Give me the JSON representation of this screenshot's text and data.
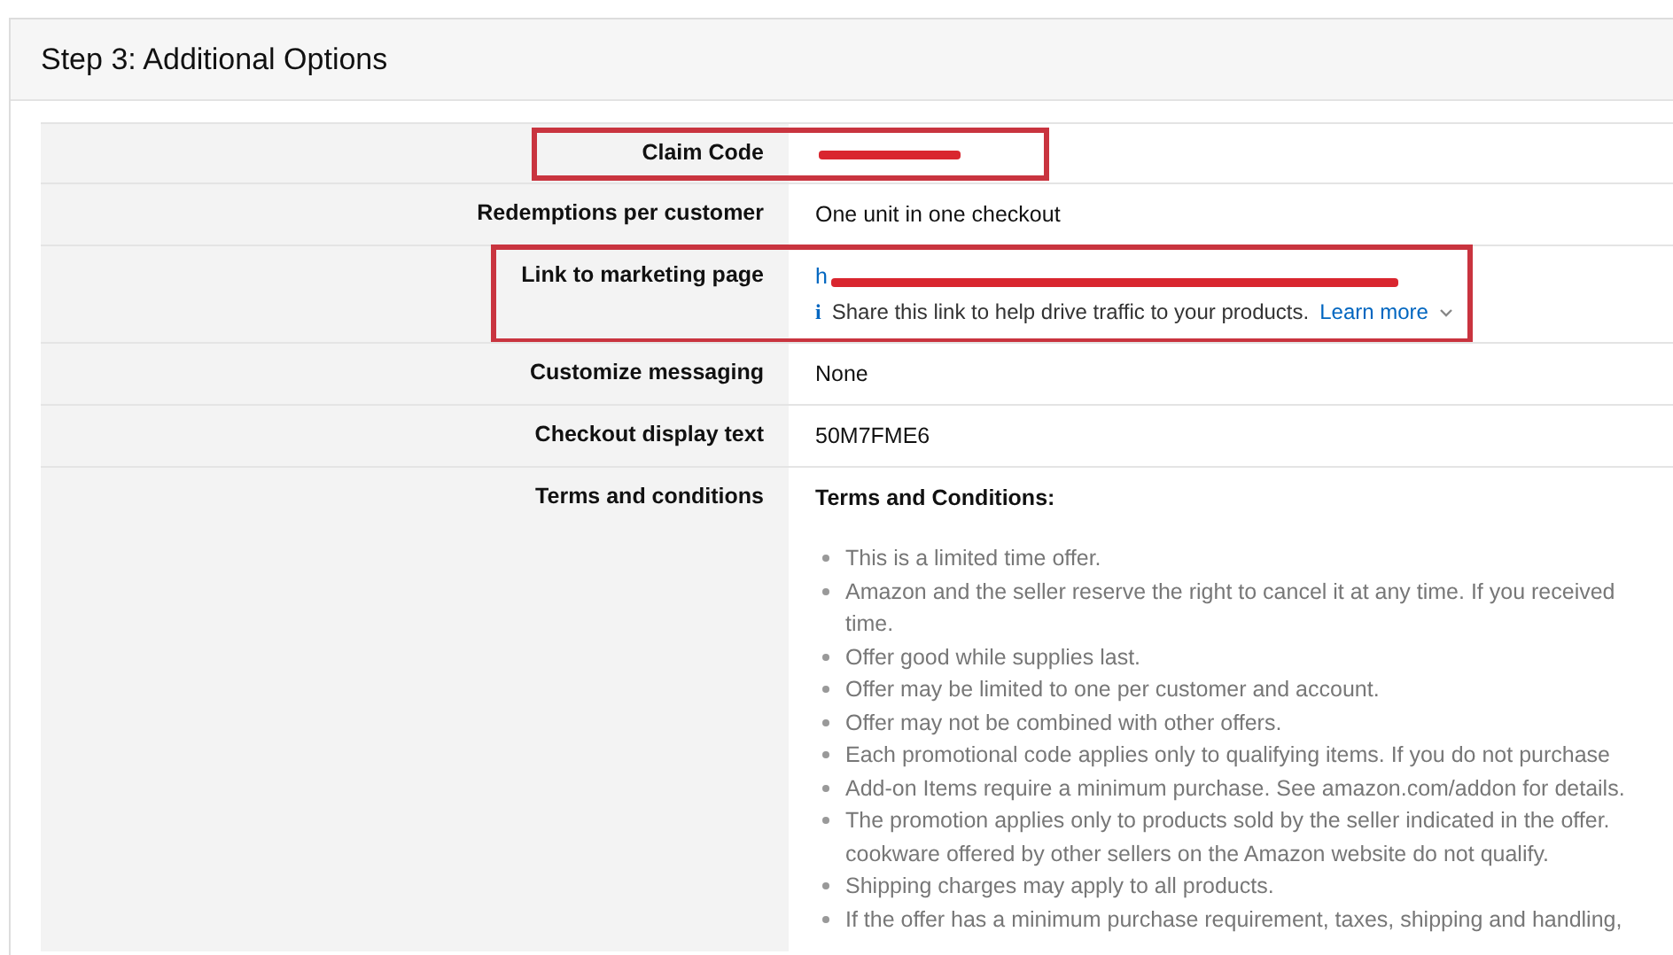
{
  "section_title": "Step 3: Additional Options",
  "rows": [
    {
      "label": "Claim Code",
      "kind": "redacted",
      "highlighted": true
    },
    {
      "label": "Redemptions per customer",
      "kind": "text",
      "value": "One unit in one checkout",
      "highlighted": false
    },
    {
      "label": "Link to marketing page",
      "kind": "link",
      "value": "h",
      "redacted": true,
      "highlighted": true,
      "info_icon": "i",
      "hint": "Share this link to help drive traffic to your products.",
      "hint_link": "Learn more"
    },
    {
      "label": "Customize messaging",
      "kind": "text",
      "value": "None",
      "highlighted": false
    },
    {
      "label": "Checkout display text",
      "kind": "text",
      "value": "50M7FME6",
      "highlighted": false
    },
    {
      "label": "Terms and conditions",
      "kind": "terms",
      "highlighted": false,
      "heading": "Terms and Conditions:",
      "items": [
        {
          "lines": [
            "This is a limited time offer."
          ]
        },
        {
          "lines": [
            "Amazon and the seller reserve the right to cancel it at any time. If you received",
            "time."
          ]
        },
        {
          "lines": [
            "Offer good while supplies last."
          ]
        },
        {
          "lines": [
            "Offer may be limited to one per customer and account."
          ]
        },
        {
          "lines": [
            "Offer may not be combined with other offers."
          ]
        },
        {
          "lines": [
            "Each promotional code applies only to qualifying items. If you do not purchase"
          ]
        },
        {
          "lines": [
            "Add-on Items require a minimum purchase. See amazon.com/addon for details."
          ]
        },
        {
          "lines": [
            "The promotion applies only to products sold by the seller indicated in the offer.",
            "cookware offered by other sellers on the Amazon website do not qualify."
          ]
        },
        {
          "lines": [
            "Shipping charges may apply to all products."
          ]
        },
        {
          "lines": [
            "If the offer has a minimum purchase requirement, taxes, shipping and handling,"
          ]
        }
      ]
    }
  ]
}
